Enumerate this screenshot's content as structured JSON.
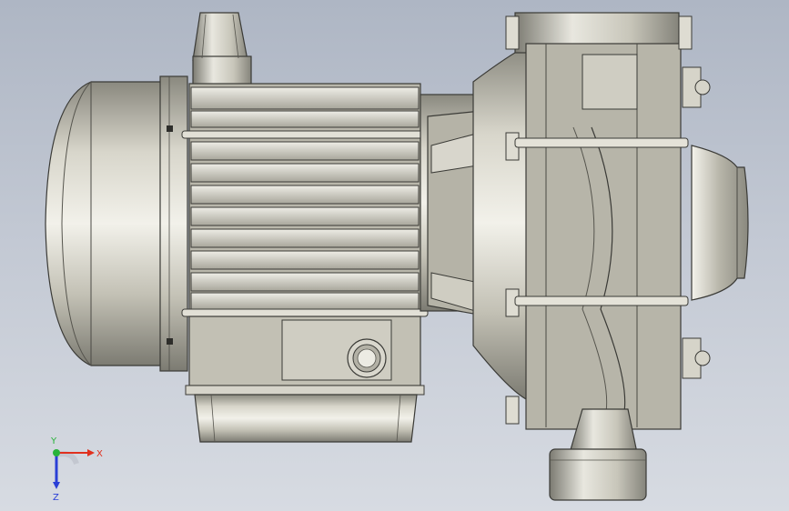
{
  "viewport": {
    "background_top": "#aeb6c4",
    "background_bottom": "#d7dbe2"
  },
  "model": {
    "body_color": "#b9b7ab",
    "edge_color": "#3a3a36",
    "highlight_color": "#f2f1ea",
    "shadow_color": "#6f6e66"
  },
  "triad": {
    "x_label": "X",
    "y_label": "Y",
    "z_label": "Z",
    "x_color": "#e0301e",
    "y_color": "#28b33a",
    "z_color": "#2a3fd6"
  }
}
